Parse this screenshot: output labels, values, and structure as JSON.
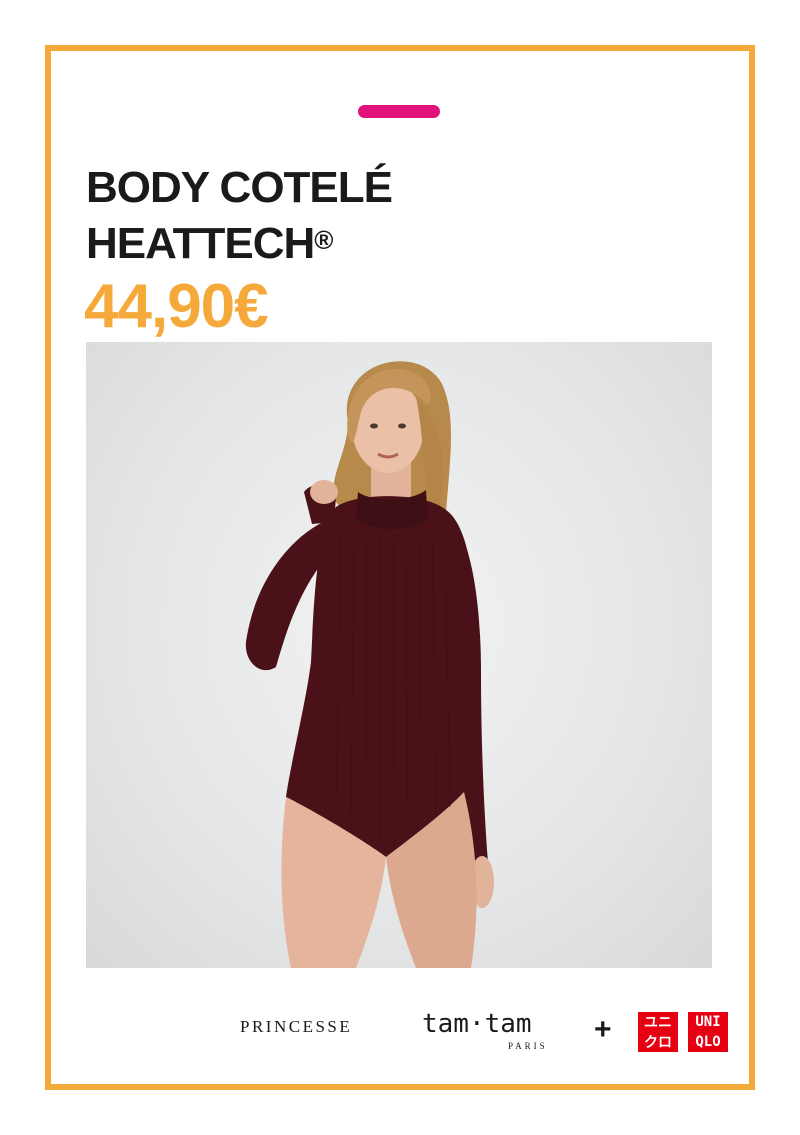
{
  "colors": {
    "frame": "#f6a93b",
    "accent_dash": "#e2127c",
    "title": "#1a1a1a",
    "price": "#f6a93b",
    "uniqlo_red": "#e60012",
    "garment": "#4a1218"
  },
  "product": {
    "title_line1": "BODY COTELÉ",
    "title_line2": "HEATTECH",
    "title_mark": "®",
    "price": "44,90€"
  },
  "photo": {
    "subject": "model-wearing-ribbed-bodysuit"
  },
  "logos": {
    "princesse": "PRINCESSE",
    "tamtam": "tam·tam",
    "paris": "PARIS",
    "plus": "+",
    "uniqlo_katakana_top": "ユニ",
    "uniqlo_katakana_bottom": "クロ",
    "uniqlo_latin_top": "UNI",
    "uniqlo_latin_bottom": "QLO"
  }
}
